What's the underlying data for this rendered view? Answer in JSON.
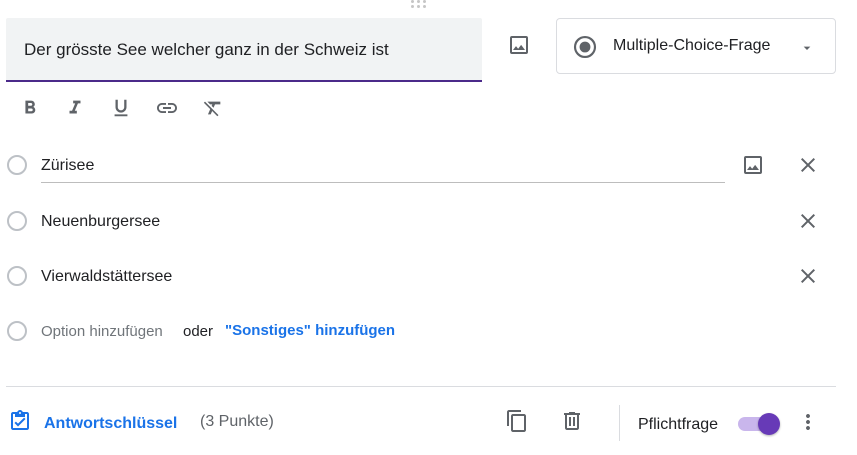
{
  "question": {
    "title": "Der grösste See welcher ganz in der Schweiz ist",
    "type_label": "Multiple-Choice-Frage"
  },
  "formatting": {
    "icons": [
      "bold-icon",
      "italic-icon",
      "underline-icon",
      "link-icon",
      "clear-formatting-icon"
    ]
  },
  "options": [
    {
      "label": "Zürisee",
      "has_image_button": true
    },
    {
      "label": "Neuenburgersee",
      "has_image_button": false
    },
    {
      "label": "Vierwaldstättersee",
      "has_image_button": false
    }
  ],
  "add_option": {
    "placeholder": "Option hinzufügen",
    "or_text": "oder",
    "other_link": "\"Sonstiges\" hinzufügen"
  },
  "footer": {
    "answer_key_label": "Antwortschlüssel",
    "points": "(3 Punkte)",
    "required_label": "Pflichtfrage",
    "required_on": true
  },
  "colors": {
    "accent": "#673ab7",
    "link": "#1a73e8",
    "icon": "#5f6368"
  }
}
